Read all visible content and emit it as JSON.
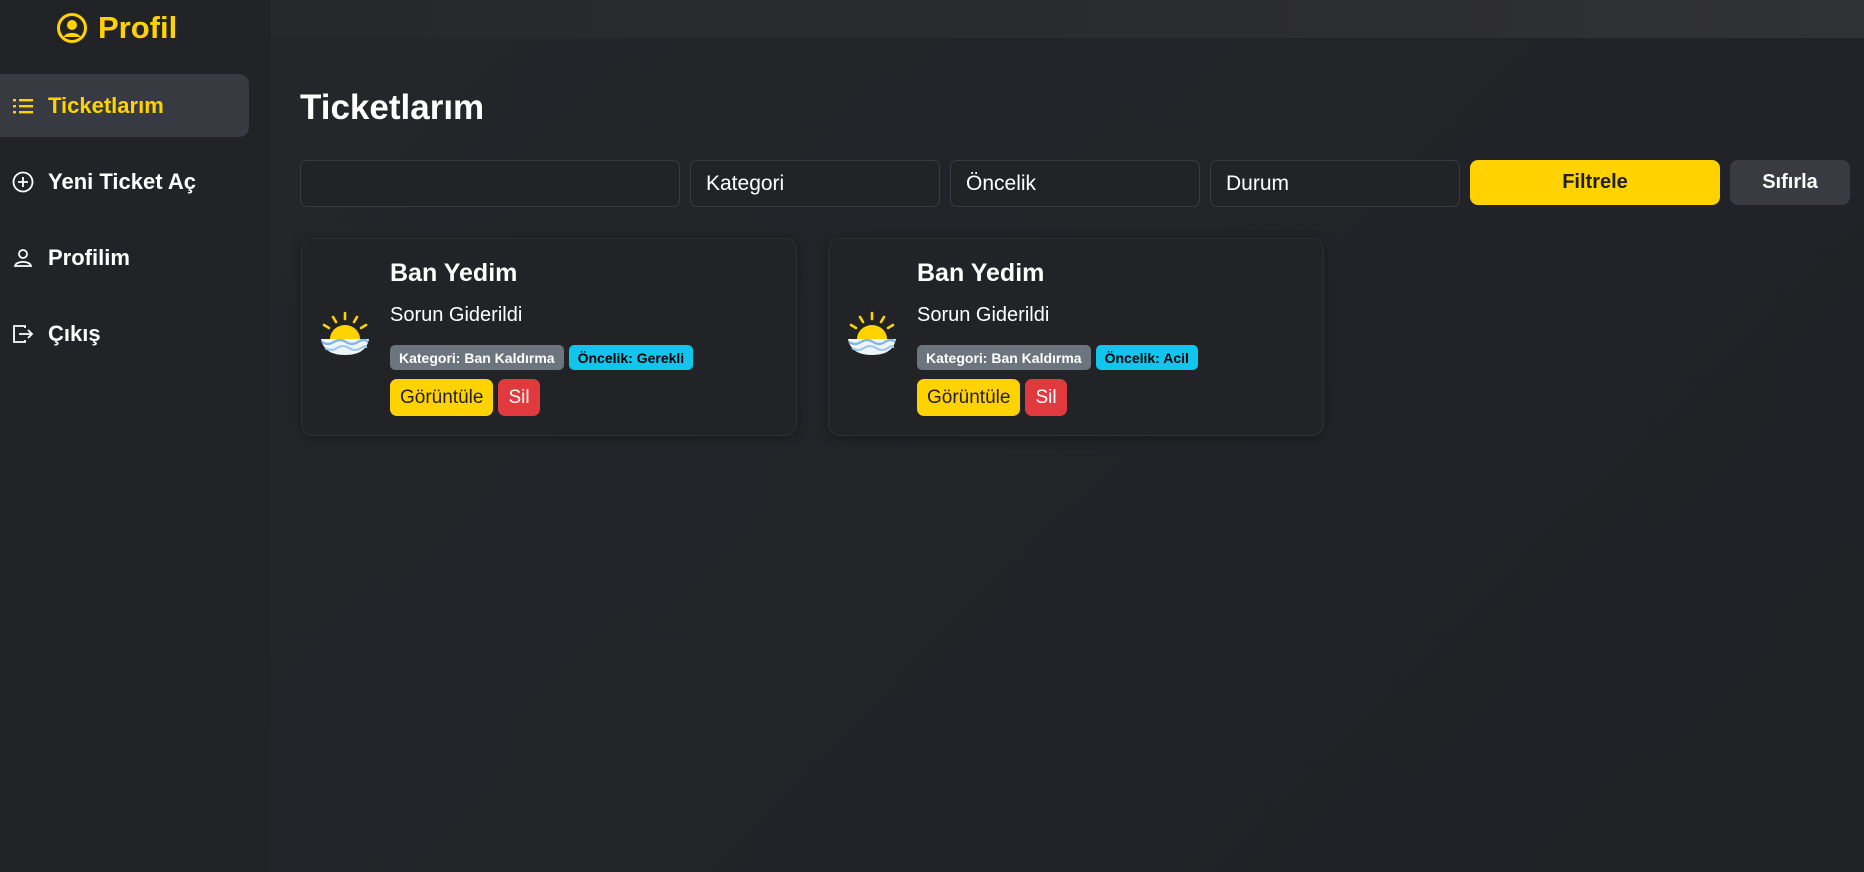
{
  "sidebar": {
    "brand": "Profil",
    "items": [
      {
        "label": "Ticketlarım",
        "icon": "list-icon",
        "active": true
      },
      {
        "label": "Yeni Ticket Aç",
        "icon": "plus-circle-icon",
        "active": false
      },
      {
        "label": "Profilim",
        "icon": "user-icon",
        "active": false
      },
      {
        "label": "Çıkış",
        "icon": "logout-icon",
        "active": false
      }
    ]
  },
  "main": {
    "title": "Ticketlarım",
    "filters": {
      "search_value": "",
      "category": "Kategori",
      "priority": "Öncelik",
      "status": "Durum",
      "filter_button": "Filtrele",
      "reset_button": "Sıfırla"
    },
    "tickets": [
      {
        "title": "Ban Yedim",
        "status": "Sorun Giderildi",
        "category_badge": "Kategori: Ban Kaldırma",
        "priority_badge": "Öncelik: Gerekli",
        "view_button": "Görüntüle",
        "delete_button": "Sil",
        "icon": "sunrise-icon"
      },
      {
        "title": "Ban Yedim",
        "status": "Sorun Giderildi",
        "category_badge": "Kategori: Ban Kaldırma",
        "priority_badge": "Öncelik: Acil",
        "view_button": "Görüntüle",
        "delete_button": "Sil",
        "icon": "sunrise-icon"
      }
    ]
  },
  "colors": {
    "accent": "#ffd200",
    "background": "#212327",
    "danger": "#e03a3e",
    "info": "#11c5ec",
    "secondary": "#6c757d"
  }
}
